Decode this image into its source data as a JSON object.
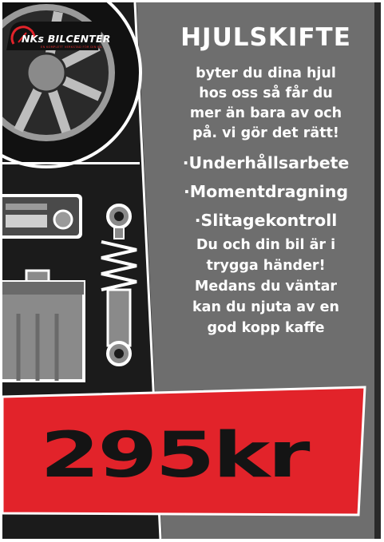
{
  "brand": {
    "name": "NKs BILCENTER",
    "tagline": "EN KOMPLETT VERKSTAD FÖR DIN BIL"
  },
  "headline": "HJULSKIFTE",
  "intro_lines": [
    "byter du dina hjul",
    "hos oss så får du",
    "mer än bara av och",
    "på. vi gör det rätt!"
  ],
  "services": [
    "·Underhållsarbete",
    "·Momentdragning",
    "·Slitagekontroll"
  ],
  "outro_lines": [
    "Du och din bil är i",
    "trygga händer!",
    "Medans du väntar",
    "kan du njuta av en",
    "god kopp kaffe"
  ],
  "price": "295kr",
  "colors": {
    "accent_red": "#e2232a",
    "panel_gray": "#6e6e6e",
    "background_dark": "#1b1b1b",
    "text": "#ffffff"
  },
  "icons": [
    "tire-icon",
    "car-radio-icon",
    "shock-absorber-icon",
    "car-battery-icon"
  ]
}
